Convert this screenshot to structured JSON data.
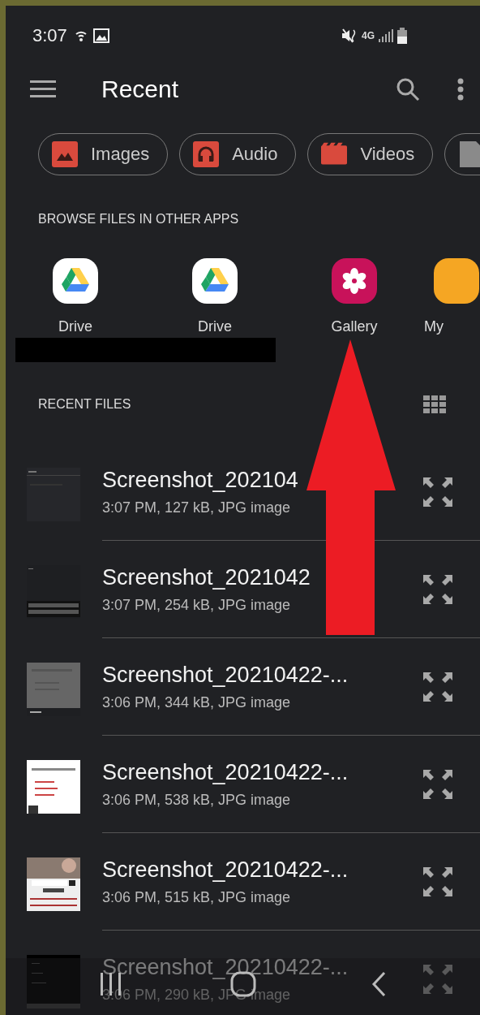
{
  "status_bar": {
    "time": "3:07",
    "network": "4G"
  },
  "toolbar": {
    "title": "Recent"
  },
  "chips": [
    {
      "kind": "images",
      "label": "Images"
    },
    {
      "kind": "audio",
      "label": "Audio"
    },
    {
      "kind": "videos",
      "label": "Videos"
    },
    {
      "kind": "documents"
    }
  ],
  "browse_section": {
    "header": "BROWSE FILES IN OTHER APPS",
    "apps": [
      {
        "kind": "drive",
        "label": "Drive"
      },
      {
        "kind": "drive",
        "label": "Drive"
      },
      {
        "kind": "gallery",
        "label": "Gallery"
      },
      {
        "kind": "myfiles",
        "label": "My"
      }
    ]
  },
  "recent_section": {
    "header": "RECENT FILES",
    "files": [
      {
        "name": "Screenshot_202104",
        "meta": "3:07 PM, 127 kB, JPG image"
      },
      {
        "name": "Screenshot_2021042",
        "meta": "3:07 PM, 254 kB, JPG image"
      },
      {
        "name": "Screenshot_20210422-...",
        "meta": "3:06 PM, 344 kB, JPG image"
      },
      {
        "name": "Screenshot_20210422-...",
        "meta": "3:06 PM, 538 kB, JPG image"
      },
      {
        "name": "Screenshot_20210422-...",
        "meta": "3:06 PM, 515 kB, JPG image"
      },
      {
        "name": "Screenshot_20210422-...",
        "meta": "3:06 PM, 290 kB, JPG image"
      }
    ]
  },
  "overlays": {
    "redaction_bar": true,
    "annotation_arrow": true
  }
}
